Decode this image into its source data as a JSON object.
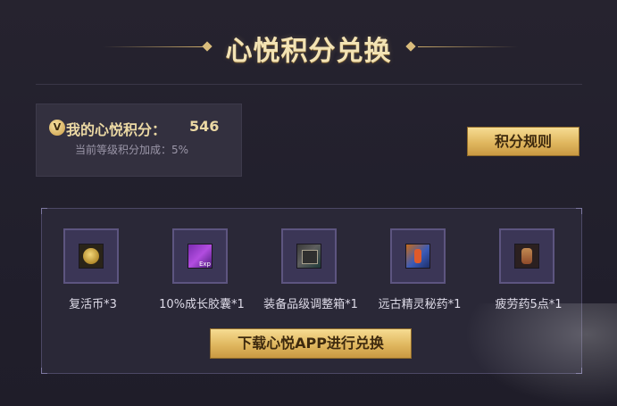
{
  "header": {
    "title": "心悦积分兑换"
  },
  "points": {
    "badge": "V",
    "label": "我的心悦积分：",
    "value": "546",
    "bonus_text": "当前等级积分加成：5%"
  },
  "rules_button": {
    "label": "积分规则"
  },
  "items": [
    {
      "name": "复活币*3",
      "icon": "revive-coin-icon"
    },
    {
      "name": "10%成长胶囊*1",
      "icon": "growth-capsule-icon"
    },
    {
      "name": "装备品级调整箱*1",
      "icon": "equipment-grade-box-icon"
    },
    {
      "name": "远古精灵秘药*1",
      "icon": "ancient-elf-potion-icon"
    },
    {
      "name": "疲劳药5点*1",
      "icon": "fatigue-potion-icon"
    }
  ],
  "download_button": {
    "label": "下载心悦APP进行兑换"
  },
  "colors": {
    "background": "#23212f",
    "gold_accent": "#e0b75f",
    "title_text": "#f3e3b4"
  }
}
